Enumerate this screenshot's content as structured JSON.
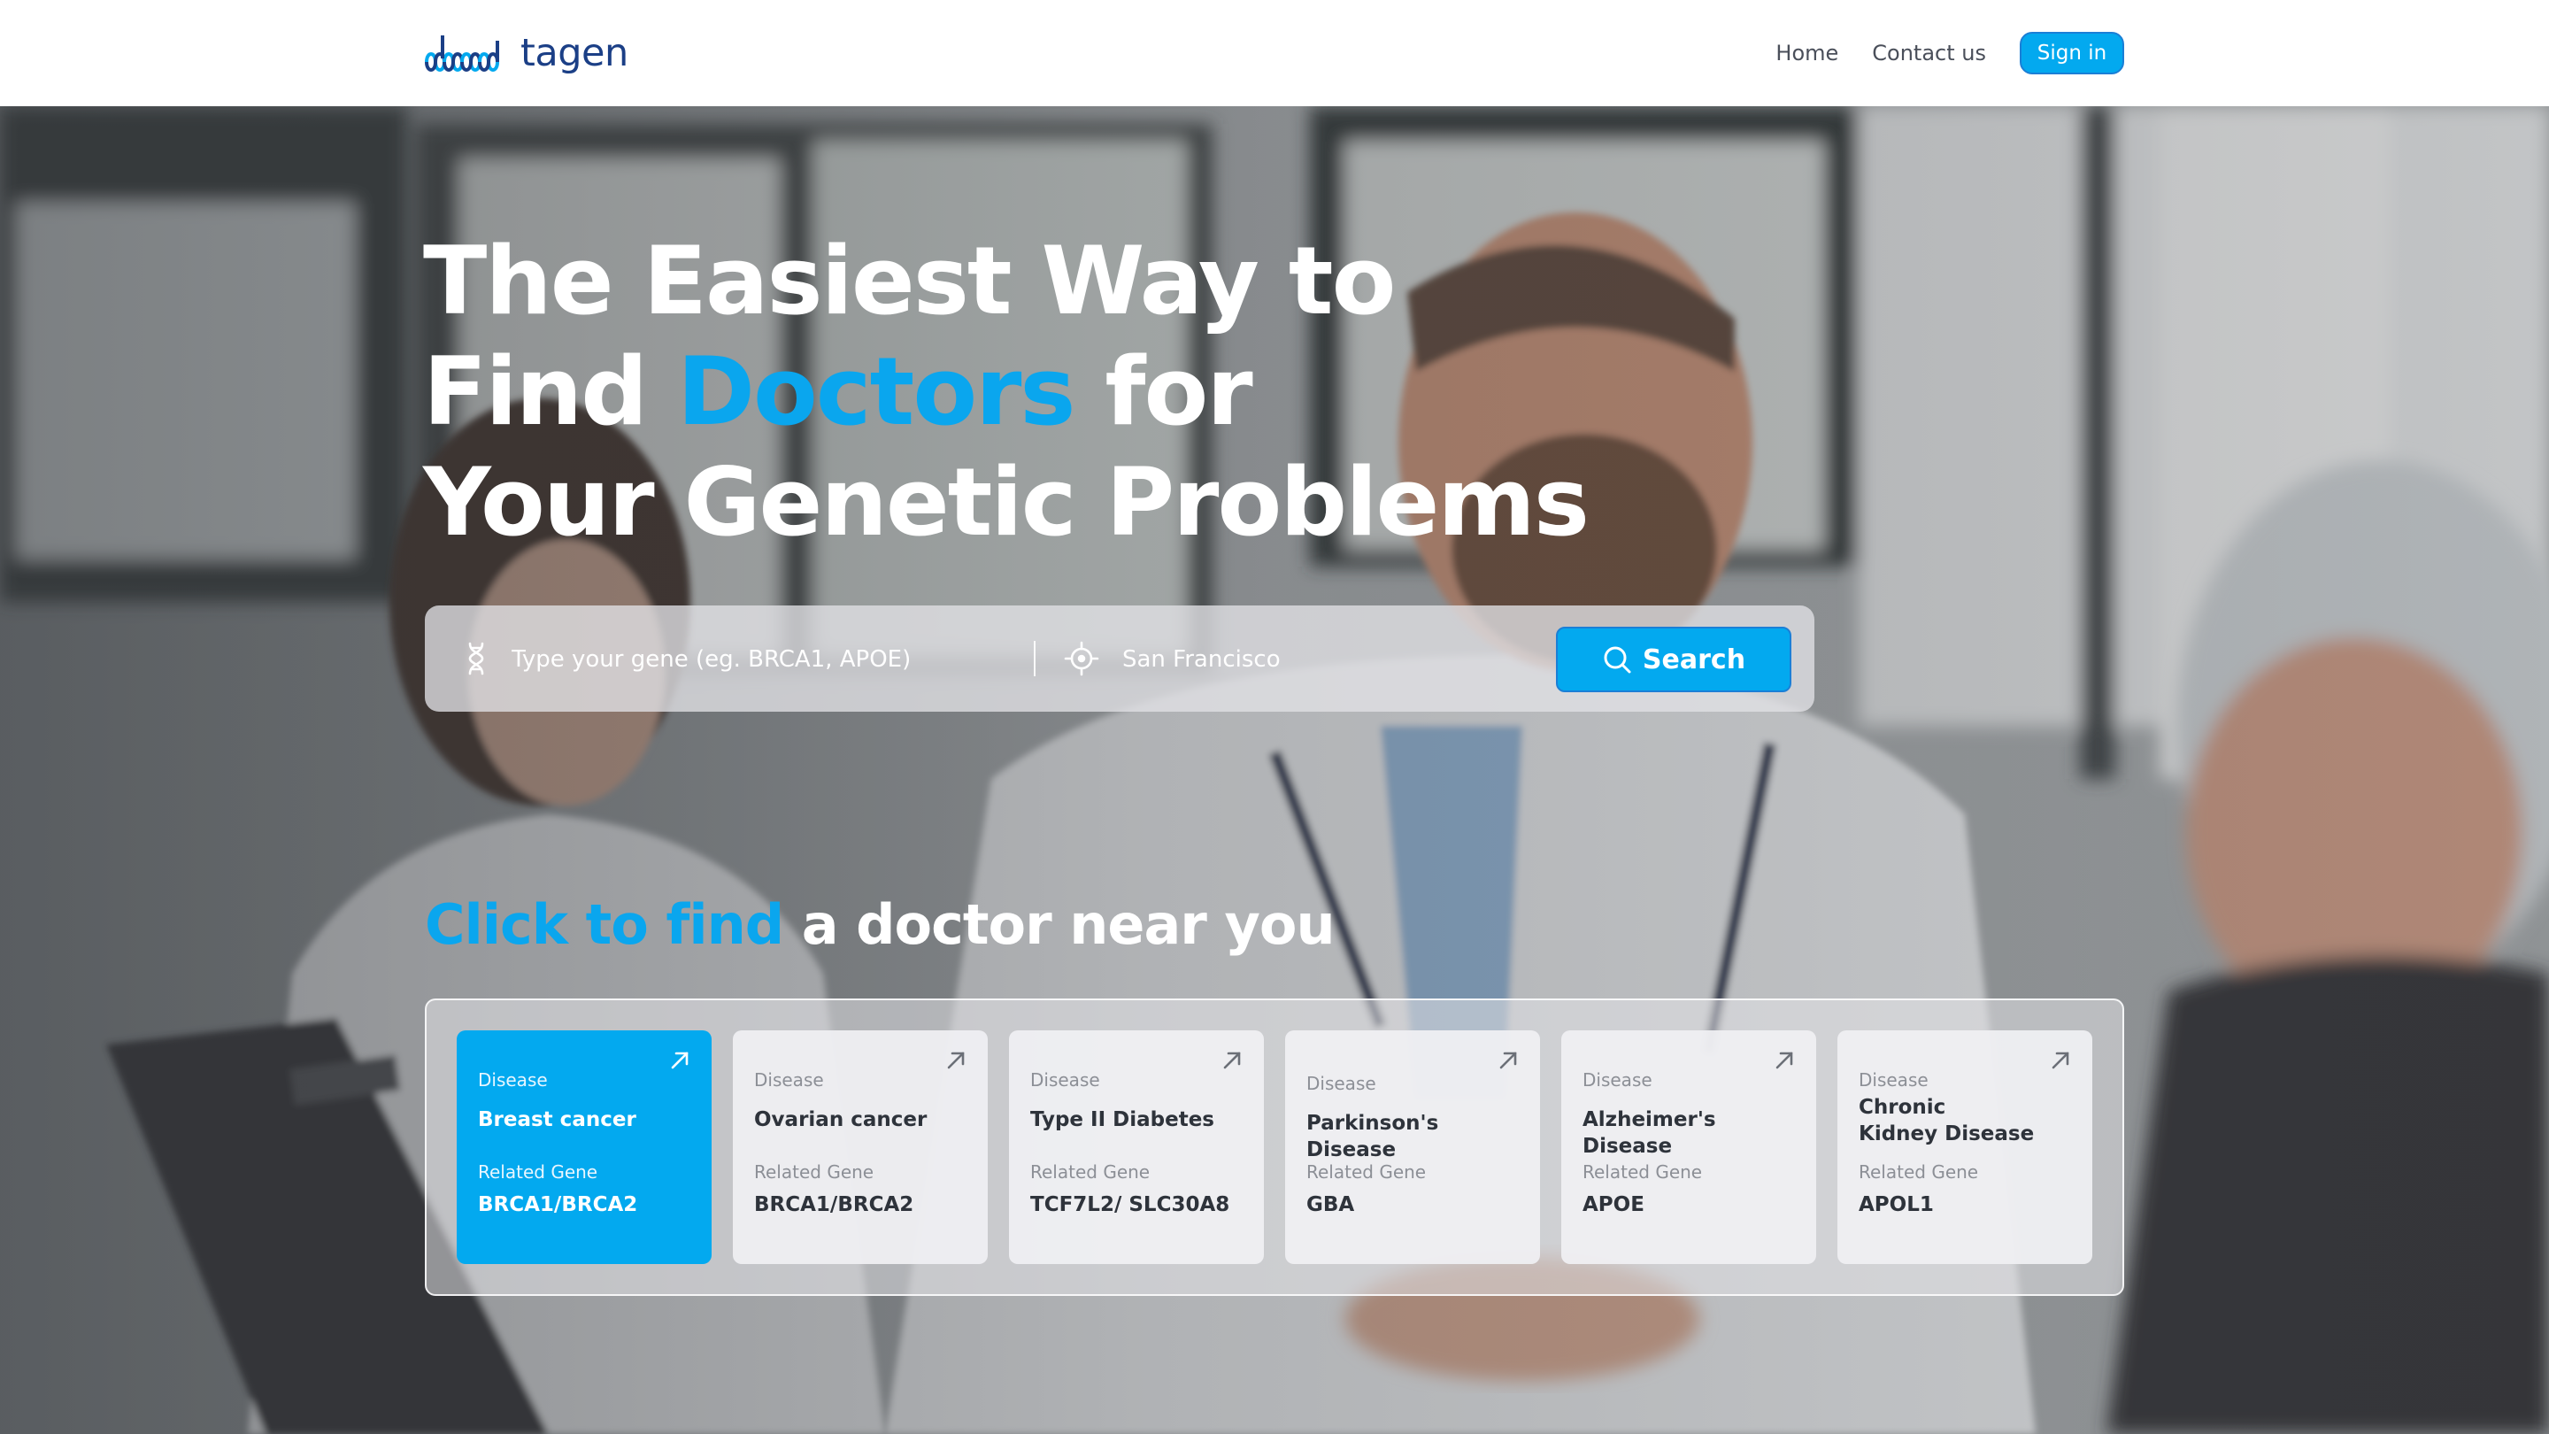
{
  "brand": {
    "name": "tagen",
    "logo_icon": "dna-helix-logo",
    "colors": {
      "navy": "#1b3f86",
      "accent": "#03a9ef"
    }
  },
  "nav": {
    "home": "Home",
    "contact": "Contact us",
    "signin": "Sign in"
  },
  "hero": {
    "line1": "The Easiest Way to",
    "line2_pre": "Find ",
    "line2_accent": "Doctors",
    "line2_post": " for",
    "line3": "Your Genetic Problems"
  },
  "search": {
    "gene_placeholder": "Type your gene (eg. BRCA1, APOE)",
    "location_value": "San Francisco",
    "button_label": "Search",
    "gene_icon": "dna-icon",
    "location_icon": "crosshair-icon",
    "button_icon": "search-icon"
  },
  "subheading": {
    "accent": "Click to find",
    "rest": " a doctor near you"
  },
  "cards": [
    {
      "disease_label": "Disease",
      "disease": "Breast cancer",
      "gene_label": "Related Gene",
      "gene": "BRCA1/BRCA2",
      "active": true
    },
    {
      "disease_label": "Disease",
      "disease": "Ovarian cancer",
      "gene_label": "Related Gene",
      "gene": "BRCA1/BRCA2",
      "active": false
    },
    {
      "disease_label": "Disease",
      "disease": "Type II Diabetes",
      "gene_label": "Related Gene",
      "gene": "TCF7L2/ SLC30A8",
      "active": false
    },
    {
      "disease_label": "Disease",
      "disease": "Parkinson's Disease",
      "gene_label": "Related Gene",
      "gene": "GBA",
      "active": false
    },
    {
      "disease_label": "Disease",
      "disease": "Alzheimer's Disease",
      "gene_label": "Related Gene",
      "gene": "APOE",
      "active": false
    },
    {
      "disease_label": "Disease",
      "disease": "Chronic\nKidney Disease",
      "gene_label": "Related Gene",
      "gene": "APOL1",
      "active": false
    }
  ]
}
